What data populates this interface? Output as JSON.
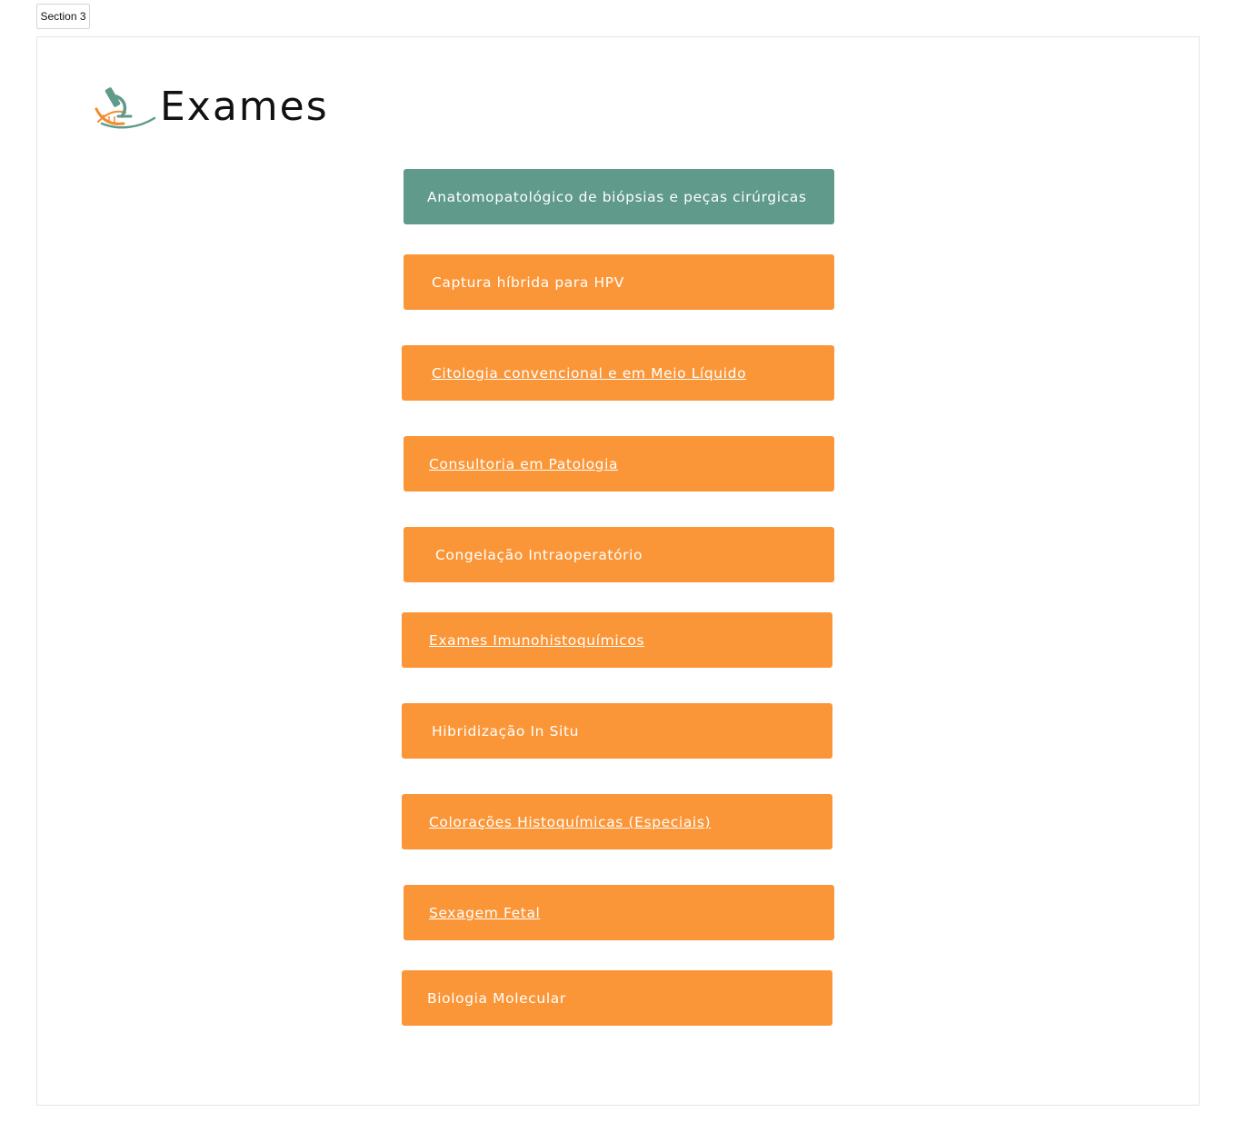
{
  "section_tab": "Section 3",
  "header": {
    "title": "Exames",
    "logo_icon": "microscope-dna-icon"
  },
  "colors": {
    "orange": "#fb9638",
    "teal": "#5f9a8b"
  },
  "exams": [
    {
      "label": "Anatomopatológico de biópsias e peças cirúrgicas",
      "active": true,
      "underlined": false
    },
    {
      "label": "Captura híbrida para HPV",
      "active": false,
      "underlined": false
    },
    {
      "label": "Citologia convencional e em Meio Líquido",
      "active": false,
      "underlined": true
    },
    {
      "label": "Consultoria em Patologia",
      "active": false,
      "underlined": true
    },
    {
      "label": "Congelação Intraoperatório",
      "active": false,
      "underlined": false
    },
    {
      "label": "Exames Imunohistoquímicos",
      "active": false,
      "underlined": true
    },
    {
      "label": "Hibridização In Situ",
      "active": false,
      "underlined": false
    },
    {
      "label": "Colorações Histoquímicas (Especiais)",
      "active": false,
      "underlined": true
    },
    {
      "label": "Sexagem Fetal",
      "active": false,
      "underlined": true
    },
    {
      "label": "Biologia Molecular",
      "active": false,
      "underlined": false
    }
  ]
}
